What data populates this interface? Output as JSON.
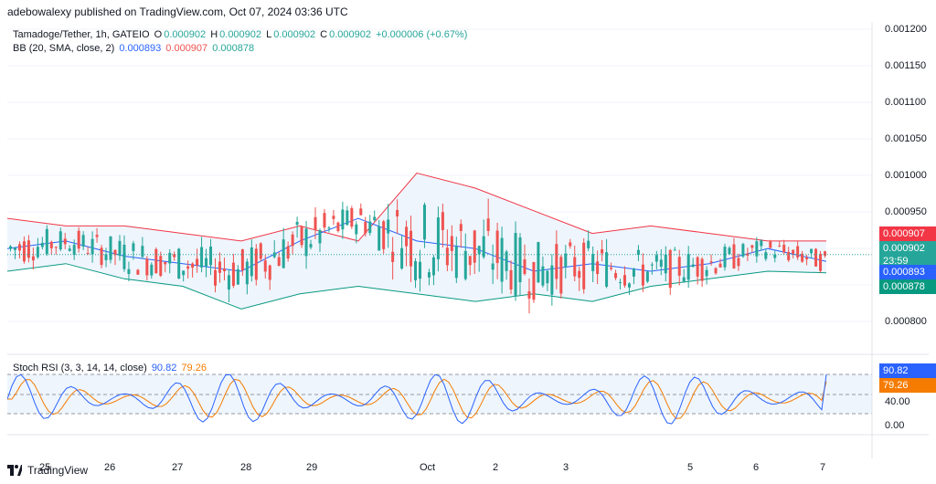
{
  "publisher": "adebowalexy published on TradingView.com, Oct 07, 2024 03:36 UTC",
  "main_legend": {
    "symbol": "Tamadoge/Tether, 1h, GATEIO",
    "o_label": "O",
    "o_value": "0.000902",
    "h_label": "H",
    "h_value": "0.000902",
    "l_label": "L",
    "l_value": "0.000902",
    "c_label": "C",
    "c_value": "0.000902",
    "change": "+0.000006 (+0.67%)"
  },
  "bb_legend": {
    "label": "BB (20, SMA, close, 2)",
    "basis": "0.000893",
    "upper": "0.000907",
    "lower": "0.000878"
  },
  "stoch_legend": {
    "label": "Stoch RSI (3, 3, 14, 14, close)",
    "k": "90.82",
    "d": "79.26"
  },
  "price_axis": [
    "0.001200",
    "0.001150",
    "0.001100",
    "0.001050",
    "0.001000",
    "0.000950",
    "0.000800"
  ],
  "price_tags": {
    "upper": "0.000907",
    "last": "0.000902",
    "countdown": "23:59",
    "basis": "0.000893",
    "lower": "0.000878"
  },
  "stoch_axis": [
    "40.00",
    "0.00"
  ],
  "stoch_tags": {
    "k": "90.82",
    "d": "79.26"
  },
  "time_axis": [
    "25",
    "26",
    "27",
    "28",
    "29",
    "Oct",
    "2",
    "3",
    "5",
    "6",
    "7"
  ],
  "footer": "TradingView",
  "colors": {
    "up": "#26a69a",
    "down": "#ef5350",
    "basis": "#2962ff",
    "upper_band": "#f23645",
    "lower_band": "#089981",
    "stoch_k": "#2962ff",
    "stoch_d": "#f57c00",
    "band_fill": "#eef5fd"
  },
  "chart_data": {
    "type": "candlestick",
    "price_range": [
      0.00077,
      0.00121
    ],
    "x": [
      "25",
      "26",
      "27",
      "28",
      "29",
      "Oct",
      "2",
      "3",
      "5",
      "6",
      "7"
    ],
    "upper_band": [
      0.00095,
      0.00094,
      0.00094,
      0.00093,
      0.00092,
      0.00094,
      0.00092,
      0.00101,
      0.00099,
      0.00096,
      0.00093,
      0.00094,
      0.00093,
      0.00092,
      0.00092
    ],
    "basis": [
      0.00091,
      0.00092,
      0.0009,
      0.00089,
      0.00088,
      0.00092,
      0.00095,
      0.00092,
      0.00091,
      0.00088,
      0.00089,
      0.00088,
      0.00089,
      0.00091,
      0.000893
    ],
    "lower_band": [
      0.00088,
      0.00089,
      0.00087,
      0.00086,
      0.00083,
      0.00085,
      0.00086,
      0.00085,
      0.00084,
      0.00085,
      0.00084,
      0.00086,
      0.00087,
      0.00088,
      0.000878
    ],
    "last_close": 0.000902,
    "stoch_range": [
      0,
      100
    ],
    "stoch_k_last": 90.82,
    "stoch_d_last": 79.26
  }
}
